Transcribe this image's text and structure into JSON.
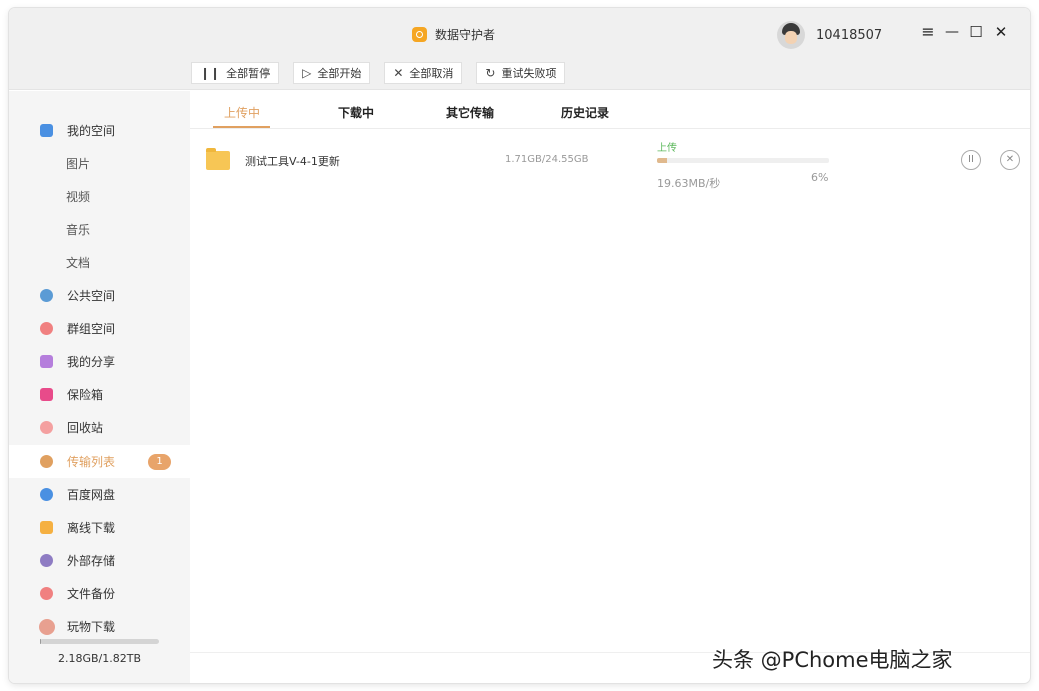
{
  "window": {
    "title": "数据守护者"
  },
  "user": {
    "id": "10418507"
  },
  "window_controls": {
    "menu": "≡",
    "minimize": "—",
    "maximize": "☐",
    "close": "✕"
  },
  "toolbar": {
    "pause_all": "全部暂停",
    "start_all": "全部开始",
    "cancel_all": "全部取消",
    "retry_failed": "重试失败项"
  },
  "sidebar": {
    "items": [
      {
        "label": "我的空间",
        "icon": "my-space-icon",
        "color": "#4a90e2"
      },
      {
        "label": "图片"
      },
      {
        "label": "视频"
      },
      {
        "label": "音乐"
      },
      {
        "label": "文档"
      },
      {
        "label": "公共空间",
        "icon": "paper-plane-icon",
        "color": "#5b9bd5"
      },
      {
        "label": "群组空间",
        "icon": "group-icon",
        "color": "#f08080"
      },
      {
        "label": "我的分享",
        "icon": "share-icon",
        "color": "#b57edc"
      },
      {
        "label": "保险箱",
        "icon": "safe-icon",
        "color": "#e84b8a"
      },
      {
        "label": "回收站",
        "icon": "trash-icon",
        "color": "#f4a0a0"
      },
      {
        "label": "传输列表",
        "icon": "transfer-icon",
        "color": "#e0a060",
        "badge": "1"
      },
      {
        "label": "百度网盘",
        "icon": "baidu-cloud-icon",
        "color": "#4a90e2"
      },
      {
        "label": "离线下载",
        "icon": "offline-download-icon",
        "color": "#f5b041"
      },
      {
        "label": "外部存储",
        "icon": "external-storage-icon",
        "color": "#8e7cc3"
      },
      {
        "label": "文件备份",
        "icon": "backup-icon",
        "color": "#f08080"
      },
      {
        "label": "玩物下载",
        "icon": "wanwu-download-icon",
        "color": "#e8a090"
      }
    ],
    "storage": "2.18GB/1.82TB",
    "storage_used_fraction": 0.0012
  },
  "tabs": [
    "上传中",
    "下载中",
    "其它传输",
    "历史记录"
  ],
  "transfer": {
    "name": "测试工具V-4-1更新",
    "size": "1.71GB/24.55GB",
    "status": "上传",
    "speed": "19.63MB/秒",
    "percent": "6%",
    "progress": 0.06,
    "pause_icon": "II",
    "close_icon": "✕"
  },
  "watermark": "头条 @PChome电脑之家",
  "colors": {
    "accent": "#e0a060",
    "status_green": "#5cb85c",
    "folder": "#f7c655"
  }
}
